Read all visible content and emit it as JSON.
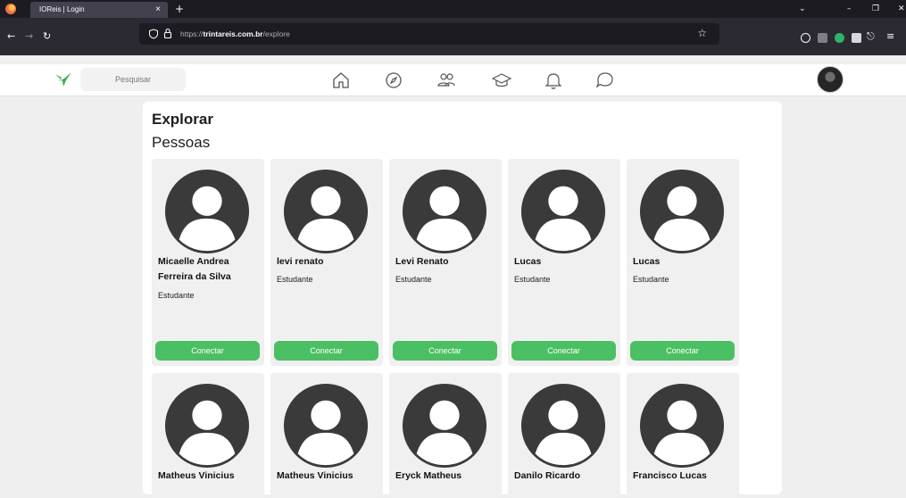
{
  "browser": {
    "tab_title": "IOReis | Login",
    "tab_close": "×",
    "new_tab": "+",
    "url_prefix": "https://",
    "url_domain": "trintareis.com.br",
    "url_path": "/explore"
  },
  "header": {
    "search_placeholder": "Pesquisar"
  },
  "page": {
    "title": "Explorar",
    "subtitle": "Pessoas"
  },
  "colors": {
    "accent": "#4bbf63",
    "avatar_gray": "#3a3a3a"
  },
  "people": [
    {
      "name": "Micaelle Andrea Ferreira da Silva",
      "role": "Estudante",
      "button": "Conectar"
    },
    {
      "name": "levi renato",
      "role": "Estudante",
      "button": "Conectar"
    },
    {
      "name": "Levi Renato",
      "role": "Estudante",
      "button": "Conectar"
    },
    {
      "name": "Lucas",
      "role": "Estudante",
      "button": "Conectar"
    },
    {
      "name": "Lucas",
      "role": "Estudante",
      "button": "Conectar"
    },
    {
      "name": "Matheus Vinicius",
      "role": "",
      "button": ""
    },
    {
      "name": "Matheus Vinicius",
      "role": "",
      "button": ""
    },
    {
      "name": "Eryck Matheus",
      "role": "",
      "button": ""
    },
    {
      "name": "Danilo Ricardo",
      "role": "",
      "button": ""
    },
    {
      "name": "Francisco Lucas",
      "role": "",
      "button": ""
    }
  ]
}
